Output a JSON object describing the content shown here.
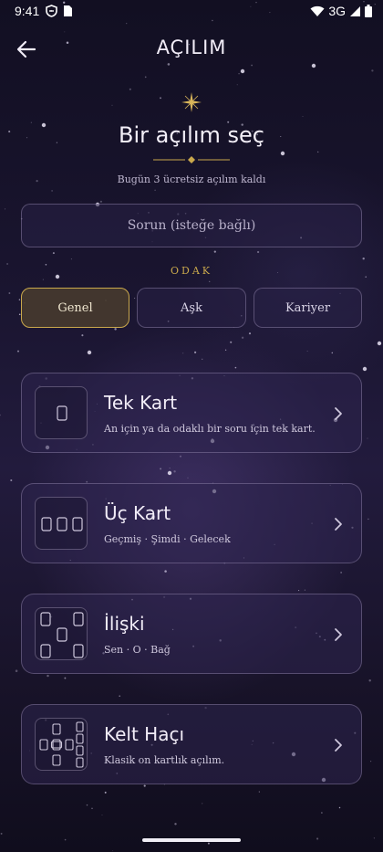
{
  "status_bar": {
    "time": "9:41",
    "network": "3G"
  },
  "app_bar": {
    "title": "AÇILIM",
    "back_icon": "arrow-left-icon"
  },
  "hero": {
    "sparkle_icon": "sparkle-icon",
    "heading": "Bir açılım seç",
    "subtitle": "Bugün 3 ücretsiz açılım kaldı"
  },
  "question": {
    "placeholder": "Sorun (isteğe bağlı)",
    "value": ""
  },
  "focus": {
    "label": "ODAK",
    "options": [
      "Genel",
      "Aşk",
      "Kariyer"
    ],
    "selected": "Genel"
  },
  "spreads": [
    {
      "title": "Tek Kart",
      "description": "An için ya da odaklı bir soru için tek kart.",
      "icon": "single-card-icon"
    },
    {
      "title": "Üç Kart",
      "description": "Geçmiş · Şimdi · Gelecek",
      "icon": "three-cards-icon"
    },
    {
      "title": "İlişki",
      "description": "Sen · O · Bağ",
      "icon": "relationship-spread-icon"
    },
    {
      "title": "Kelt Haçı",
      "description": "Klasik on kartlık açılım.",
      "icon": "celtic-cross-icon"
    }
  ],
  "colors": {
    "accent_gold": "#c9a84c",
    "background": "#1a1530",
    "card_background": "#2d244e",
    "text": "#f1ecf7"
  }
}
